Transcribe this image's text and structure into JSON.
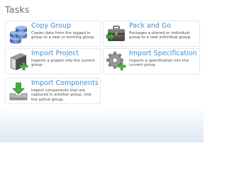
{
  "panel": {
    "title": "Tasks"
  },
  "tasks": [
    {
      "name": "Copy Group",
      "description": "Copies data from the logged in group to a new or existing group.",
      "icon": "database-stack-icon"
    },
    {
      "name": "Pack and Go",
      "description": "Packages a shared or individual group to a new individual group.",
      "icon": "briefcase-icon"
    },
    {
      "name": "Import Project",
      "description": "Imports a project into the current group",
      "icon": "project-book-import-icon"
    },
    {
      "name": "Import Specification",
      "description": "Imports a specification into the current group",
      "icon": "gear-import-icon"
    },
    {
      "name": "Import Components",
      "description": "Import components that are captured in another group, into the active group.",
      "icon": "tray-download-icon"
    }
  ],
  "colors": {
    "link": "#3f8fd1",
    "title": "#5f6f81",
    "border": "#e3e8ee"
  }
}
